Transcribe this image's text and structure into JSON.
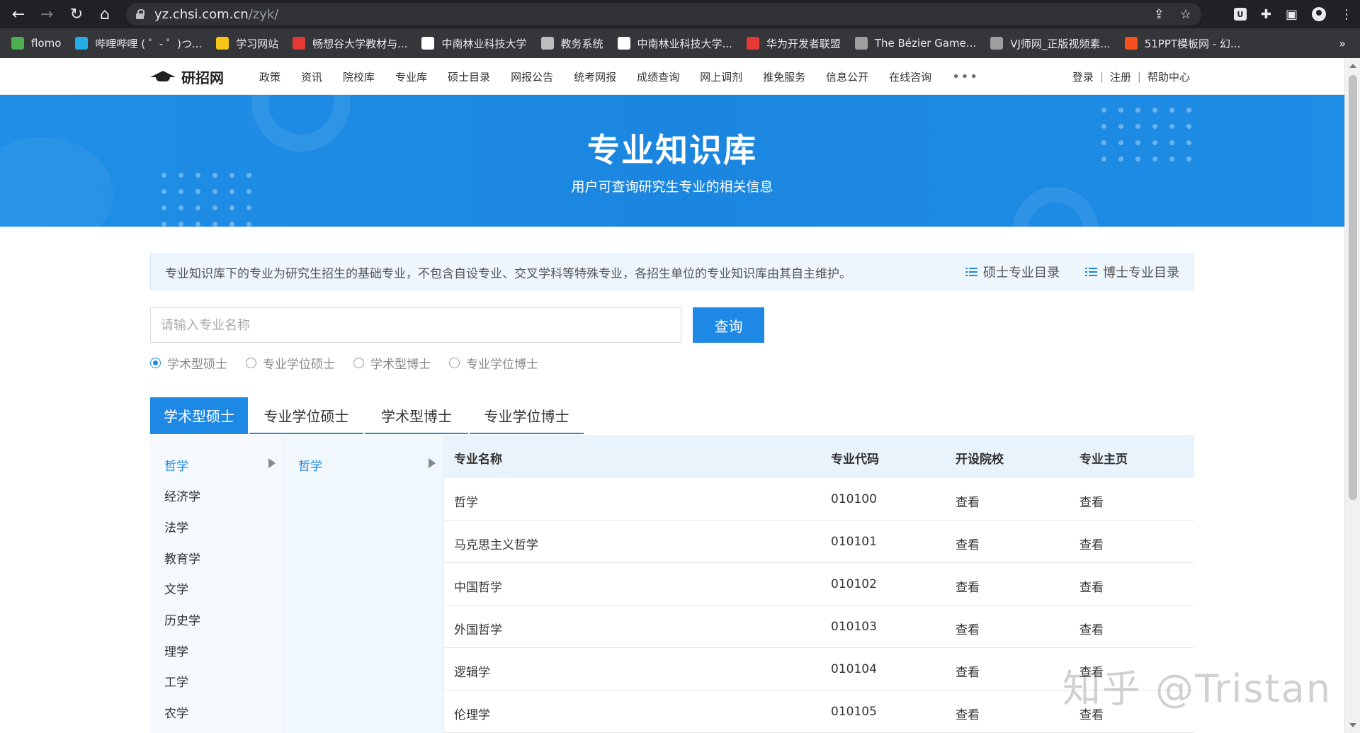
{
  "browser": {
    "url_host": "yz.chsi.com.cn",
    "url_path": "/zyk/",
    "bookmarks": [
      {
        "label": "flomo",
        "color": "#4caf50"
      },
      {
        "label": "哔哩哔哩 ( ゜- ゜)つ...",
        "color": "#23ade5"
      },
      {
        "label": "学习网站",
        "color": "#f5c518"
      },
      {
        "label": "畅想谷大学教材与...",
        "color": "#e53935"
      },
      {
        "label": "中南林业科技大学",
        "color": "#ffffff"
      },
      {
        "label": "教务系统",
        "color": "#bdbdbd"
      },
      {
        "label": "中南林业科技大学...",
        "color": "#ffffff"
      },
      {
        "label": "华为开发者联盟",
        "color": "#e53935"
      },
      {
        "label": "The Bézier Game...",
        "color": "#9e9e9e"
      },
      {
        "label": "VJ师网_正版视频素...",
        "color": "#9e9e9e"
      },
      {
        "label": "51PPT模板网 - 幻...",
        "color": "#f4511e"
      }
    ],
    "more_label": "»"
  },
  "site": {
    "logo": "研招网",
    "nav": [
      "政策",
      "资讯",
      "院校库",
      "专业库",
      "硕士目录",
      "网报公告",
      "统考网报",
      "成绩查询",
      "网上调剂",
      "推免服务",
      "信息公开",
      "在线咨询"
    ],
    "nav_more": "•••",
    "user_links": {
      "login": "登录",
      "register": "注册",
      "help": "帮助中心",
      "sep": "|"
    }
  },
  "banner": {
    "title": "专业知识库",
    "subtitle": "用户可查询研究生专业的相关信息"
  },
  "notice": {
    "text": "专业知识库下的专业为研究生招生的基础专业，不包含自设专业、交叉学科等特殊专业，各招生单位的专业知识库由其自主维护。",
    "master_catalog": "硕士专业目录",
    "doctor_catalog": "博士专业目录"
  },
  "search": {
    "placeholder": "请输入专业名称",
    "button": "查询",
    "radios": [
      {
        "label": "学术型硕士",
        "checked": true
      },
      {
        "label": "专业学位硕士",
        "checked": false
      },
      {
        "label": "学术型博士",
        "checked": false
      },
      {
        "label": "专业学位博士",
        "checked": false
      }
    ]
  },
  "tabs": [
    "学术型硕士",
    "专业学位硕士",
    "学术型博士",
    "专业学位博士"
  ],
  "categories": [
    "哲学",
    "经济学",
    "法学",
    "教育学",
    "文学",
    "历史学",
    "理学",
    "工学",
    "农学"
  ],
  "subcategories": [
    "哲学"
  ],
  "table": {
    "headers": {
      "name": "专业名称",
      "code": "专业代码",
      "schools": "开设院校",
      "home": "专业主页"
    },
    "rows": [
      {
        "name": "哲学",
        "code": "010100",
        "schools": "查看",
        "home": "查看"
      },
      {
        "name": "马克思主义哲学",
        "code": "010101",
        "schools": "查看",
        "home": "查看"
      },
      {
        "name": "中国哲学",
        "code": "010102",
        "schools": "查看",
        "home": "查看"
      },
      {
        "name": "外国哲学",
        "code": "010103",
        "schools": "查看",
        "home": "查看"
      },
      {
        "name": "逻辑学",
        "code": "010104",
        "schools": "查看",
        "home": "查看"
      },
      {
        "name": "伦理学",
        "code": "010105",
        "schools": "查看",
        "home": "查看"
      }
    ]
  },
  "watermark": "知乎 @Tristan"
}
